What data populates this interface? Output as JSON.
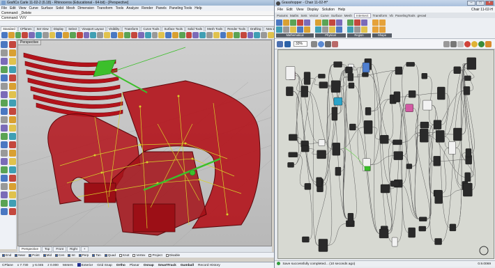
{
  "rhino": {
    "title": "GrafiCo Carle 11-02-2 (6.18) - Rhinoceros (Educational - 64-bit) - [Perspective]",
    "menu": [
      "File",
      "Edit",
      "View",
      "Curve",
      "Surface",
      "Solid",
      "Mesh",
      "Dimension",
      "Transform",
      "Tools",
      "Analyze",
      "Render",
      "Panels",
      "Paneling Tools",
      "Help"
    ],
    "command_history": "Command: _Delete",
    "command_prompt": "Command: VVV",
    "tabs": [
      "Standard",
      "CPlanes",
      "Set View",
      "Display",
      "Select",
      "Viewport Layout",
      "Visibility",
      "Transform",
      "Curve Tools",
      "Surface Tools",
      "Solid Tools",
      "Mesh Tools",
      "Render Tools",
      "Drafting",
      "New in V5"
    ],
    "viewport_label": "Perspective",
    "viewport_tabs": [
      "Perspective",
      "Top",
      "Front",
      "Right",
      "+"
    ],
    "osnaps": [
      {
        "label": "End",
        "checked": true
      },
      {
        "label": "Near",
        "checked": true
      },
      {
        "label": "Point",
        "checked": true
      },
      {
        "label": "Mid",
        "checked": true
      },
      {
        "label": "Cen",
        "checked": true
      },
      {
        "label": "Int",
        "checked": true
      },
      {
        "label": "Perp",
        "checked": true
      },
      {
        "label": "Tan",
        "checked": true
      },
      {
        "label": "Quad",
        "checked": true
      },
      {
        "label": "Knot",
        "checked": false
      },
      {
        "label": "Vertex",
        "checked": false
      },
      {
        "label": "Project",
        "checked": false
      },
      {
        "label": "Disable",
        "checked": false
      }
    ],
    "status": {
      "cplane": "CPlane",
      "x": "x 7.730",
      "y": "y 6.045",
      "z": "z 0.000",
      "units": "Meters",
      "layer": "Exterior",
      "toggles": [
        "Grid Snap",
        "Ortho",
        "Planar",
        "Osnap",
        "SmartTrack",
        "Gumball",
        "Record History"
      ],
      "layer_color": "#1e2b8c"
    }
  },
  "grasshopper": {
    "title": "Grasshopper - Chair 11-02-H*",
    "menu": [
      "File",
      "Edit",
      "View",
      "Display",
      "Solution",
      "Help"
    ],
    "doc_name": "Chair 11-02-H",
    "tabs": [
      "Params",
      "Maths",
      "Sets",
      "Vector",
      "Curve",
      "Surface",
      "Mesh",
      "Intersect",
      "Transform",
      "Vb",
      "PanelingTools",
      "gHowl"
    ],
    "active_tab": "Intersect",
    "groups": [
      "Mathematical",
      "Physical",
      "Region",
      "Shape"
    ],
    "zoom": "33%",
    "status_message": "Save successfully completed... (10 seconds ago)",
    "version": "0.9.0069"
  },
  "colors": {
    "chair_fill": "#b3131b",
    "wire_yellow": "#d8d22a",
    "preview_green": "#3cbf2b",
    "canvas_bg": "#d7d9d2",
    "component": "#2a2a2a",
    "param_pink": "#d25aa3",
    "param_blue": "#4f7fd0",
    "param_cyan": "#2aa3c9"
  }
}
